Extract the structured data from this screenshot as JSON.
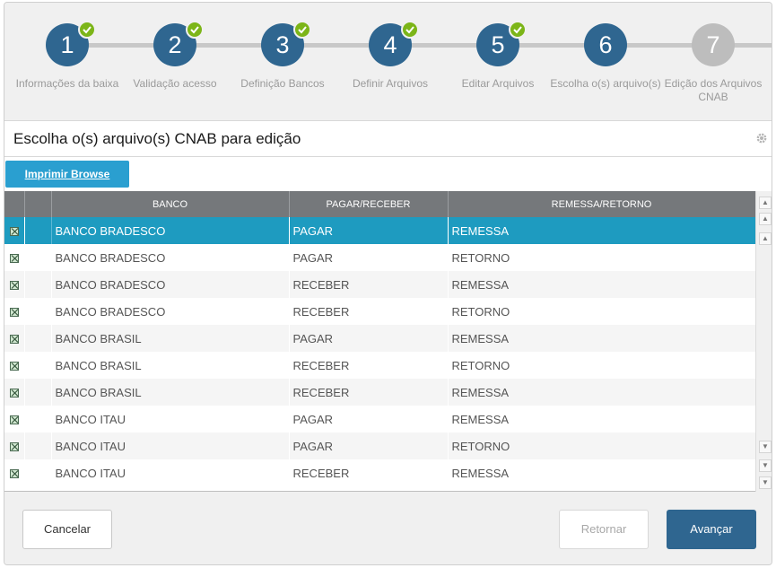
{
  "wizard": {
    "steps": [
      {
        "number": "1",
        "label": "Informações da baixa",
        "done": true
      },
      {
        "number": "2",
        "label": "Validação acesso",
        "done": true
      },
      {
        "number": "3",
        "label": "Definição Bancos",
        "done": true
      },
      {
        "number": "4",
        "label": "Definir Arquivos",
        "done": true
      },
      {
        "number": "5",
        "label": "Editar Arquivos",
        "done": true
      },
      {
        "number": "6",
        "label": "Escolha o(s) arquivo(s)",
        "done": false
      },
      {
        "number": "7",
        "label": "Edição dos Arquivos CNAB",
        "done": false
      }
    ]
  },
  "header": {
    "title": "Escolha o(s) arquivo(s) CNAB para edição",
    "icon": "gear-icon"
  },
  "toolbar": {
    "print_label": "Imprimir Browse"
  },
  "grid": {
    "columns": [
      "BANCO",
      "PAGAR/RECEBER",
      "REMESSA/RETORNO"
    ],
    "rows": [
      {
        "banco": "BANCO BRADESCO",
        "tipo": "PAGAR",
        "arquivo": "REMESSA"
      },
      {
        "banco": "BANCO BRADESCO",
        "tipo": "PAGAR",
        "arquivo": "RETORNO"
      },
      {
        "banco": "BANCO BRADESCO",
        "tipo": "RECEBER",
        "arquivo": "REMESSA"
      },
      {
        "banco": "BANCO BRADESCO",
        "tipo": "RECEBER",
        "arquivo": "RETORNO"
      },
      {
        "banco": "BANCO BRASIL",
        "tipo": "PAGAR",
        "arquivo": "REMESSA"
      },
      {
        "banco": "BANCO BRASIL",
        "tipo": "RECEBER",
        "arquivo": "RETORNO"
      },
      {
        "banco": "BANCO BRASIL",
        "tipo": "RECEBER",
        "arquivo": "REMESSA"
      },
      {
        "banco": "BANCO ITAU",
        "tipo": "PAGAR",
        "arquivo": "REMESSA"
      },
      {
        "banco": "BANCO ITAU",
        "tipo": "PAGAR",
        "arquivo": "RETORNO"
      },
      {
        "banco": "BANCO ITAU",
        "tipo": "RECEBER",
        "arquivo": "REMESSA"
      }
    ],
    "selected_row": 0
  },
  "footer": {
    "cancel_label": "Cancelar",
    "back_label": "Retornar",
    "next_label": "Avançar"
  },
  "colors": {
    "step_active": "#2f6690",
    "step_todo": "#bdbdbd",
    "check": "#7cb518",
    "selected_row": "#1e9bc0",
    "print_button": "#2a9fd0"
  }
}
